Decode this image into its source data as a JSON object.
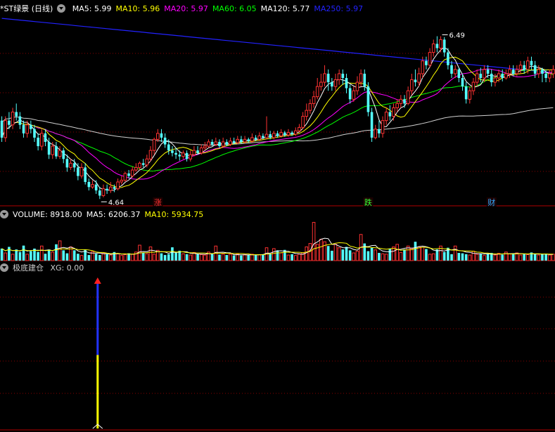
{
  "main_panel": {
    "title": "*ST绿景 (日线)",
    "ma_labels": [
      {
        "text": "MA5: 5.99",
        "color": "#ffffff"
      },
      {
        "text": "MA10: 5.96",
        "color": "#ffff00"
      },
      {
        "text": "MA20: 5.97",
        "color": "#ff00ff"
      },
      {
        "text": "MA60: 6.05",
        "color": "#00ff00"
      },
      {
        "text": "MA120: 5.77",
        "color": "#ffffff"
      },
      {
        "text": "MA250: 5.97",
        "color": "#2222ff"
      }
    ],
    "markers": [
      {
        "text": "涨",
        "color": "#ff3333",
        "index": 43
      },
      {
        "text": "跌",
        "color": "#33ff33",
        "index": 101
      },
      {
        "text": "财",
        "color": "#33aaff",
        "index": 135
      }
    ],
    "low_label": "4.64",
    "high_label": "6.49"
  },
  "volume_panel": {
    "labels": [
      {
        "text": "VOLUME: 8918.00",
        "color": "#ffffff"
      },
      {
        "text": "MA5: 6206.37",
        "color": "#ffffff"
      },
      {
        "text": "MA10: 5934.75",
        "color": "#ffff00"
      }
    ]
  },
  "indicator_panel": {
    "title": "极底建仓",
    "labels": [
      {
        "text": "XG: 0.00",
        "color": "#cccccc"
      }
    ]
  },
  "colors": {
    "up": "#ff3232",
    "down": "#54ffff",
    "grid": "#8a0000"
  },
  "chart_data": [
    {
      "type": "candlestick",
      "price_range": [
        4.5,
        6.75
      ],
      "candles": [
        [
          5.5,
          5.3,
          5.55,
          5.25
        ],
        [
          5.3,
          5.5,
          5.55,
          5.25
        ],
        [
          5.5,
          5.45,
          5.6,
          5.4
        ],
        [
          5.45,
          5.6,
          5.65,
          5.4
        ],
        [
          5.6,
          5.55,
          5.7,
          5.5
        ],
        [
          5.55,
          5.45,
          5.6,
          5.4
        ],
        [
          5.45,
          5.35,
          5.5,
          5.3
        ],
        [
          5.35,
          5.45,
          5.5,
          5.3
        ],
        [
          5.45,
          5.4,
          5.5,
          5.35
        ],
        [
          5.4,
          5.3,
          5.45,
          5.25
        ],
        [
          5.3,
          5.2,
          5.35,
          5.15
        ],
        [
          5.2,
          5.35,
          5.4,
          5.15
        ],
        [
          5.35,
          5.25,
          5.4,
          5.2
        ],
        [
          5.25,
          5.1,
          5.3,
          5.05
        ],
        [
          5.1,
          5.2,
          5.25,
          5.05
        ],
        [
          5.2,
          5.08,
          5.25,
          5.05
        ],
        [
          5.08,
          5.15,
          5.2,
          5.05
        ],
        [
          5.15,
          5.05,
          5.18,
          5.0
        ],
        [
          5.05,
          4.95,
          5.1,
          4.9
        ],
        [
          4.95,
          5.0,
          5.05,
          4.92
        ],
        [
          5.0,
          4.95,
          5.05,
          4.9
        ],
        [
          4.95,
          4.85,
          5.0,
          4.8
        ],
        [
          4.85,
          4.95,
          5.0,
          4.82
        ],
        [
          4.95,
          4.78,
          5.0,
          4.75
        ],
        [
          4.78,
          4.72,
          4.82,
          4.68
        ],
        [
          4.72,
          4.75,
          4.8,
          4.7
        ],
        [
          4.75,
          4.68,
          4.8,
          4.64
        ],
        [
          4.68,
          4.62,
          4.72,
          4.58
        ],
        [
          4.62,
          4.7,
          4.75,
          4.6
        ],
        [
          4.7,
          4.68,
          4.75,
          4.64
        ],
        [
          4.68,
          4.72,
          4.78,
          4.65
        ],
        [
          4.72,
          4.7,
          4.75,
          4.66
        ],
        [
          4.7,
          4.78,
          4.82,
          4.68
        ],
        [
          4.78,
          4.8,
          4.85,
          4.75
        ],
        [
          4.8,
          4.88,
          4.9,
          4.78
        ],
        [
          4.88,
          4.85,
          4.92,
          4.82
        ],
        [
          4.85,
          4.92,
          4.96,
          4.83
        ],
        [
          4.92,
          4.95,
          5.0,
          4.9
        ],
        [
          4.95,
          5.0,
          5.02,
          4.92
        ],
        [
          5.0,
          4.98,
          5.05,
          4.95
        ],
        [
          4.98,
          5.05,
          5.1,
          4.95
        ],
        [
          5.05,
          5.15,
          5.2,
          5.02
        ],
        [
          5.15,
          5.28,
          5.3,
          5.1
        ],
        [
          5.28,
          5.35,
          5.4,
          5.25
        ],
        [
          5.35,
          5.3,
          5.4,
          5.25
        ],
        [
          5.3,
          5.22,
          5.35,
          5.18
        ],
        [
          5.22,
          5.15,
          5.28,
          5.1
        ],
        [
          5.15,
          5.12,
          5.2,
          5.08
        ],
        [
          5.12,
          5.1,
          5.18,
          5.05
        ],
        [
          5.1,
          5.08,
          5.15,
          5.03
        ],
        [
          5.08,
          5.12,
          5.15,
          5.05
        ],
        [
          5.12,
          5.05,
          5.15,
          5.02
        ],
        [
          5.05,
          5.1,
          5.15,
          5.02
        ],
        [
          5.1,
          5.15,
          5.2,
          5.08
        ],
        [
          5.15,
          5.12,
          5.2,
          5.1
        ],
        [
          5.12,
          5.18,
          5.22,
          5.1
        ],
        [
          5.18,
          5.2,
          5.25,
          5.15
        ],
        [
          5.2,
          5.25,
          5.28,
          5.18
        ],
        [
          5.25,
          5.22,
          5.28,
          5.2
        ],
        [
          5.22,
          5.25,
          5.3,
          5.2
        ],
        [
          5.25,
          5.2,
          5.28,
          5.18
        ],
        [
          5.2,
          5.25,
          5.3,
          5.18
        ],
        [
          5.25,
          5.22,
          5.28,
          5.2
        ],
        [
          5.22,
          5.26,
          5.3,
          5.2
        ],
        [
          5.26,
          5.24,
          5.3,
          5.22
        ],
        [
          5.24,
          5.28,
          5.32,
          5.22
        ],
        [
          5.28,
          5.25,
          5.32,
          5.23
        ],
        [
          5.25,
          5.28,
          5.32,
          5.23
        ],
        [
          5.28,
          5.26,
          5.3,
          5.24
        ],
        [
          5.26,
          5.3,
          5.35,
          5.24
        ],
        [
          5.3,
          5.28,
          5.33,
          5.26
        ],
        [
          5.28,
          5.32,
          5.36,
          5.26
        ],
        [
          5.32,
          5.3,
          5.35,
          5.28
        ],
        [
          5.3,
          5.34,
          5.55,
          5.28
        ],
        [
          5.34,
          5.3,
          5.38,
          5.28
        ],
        [
          5.3,
          5.35,
          5.38,
          5.28
        ],
        [
          5.35,
          5.32,
          5.38,
          5.3
        ],
        [
          5.32,
          5.36,
          5.4,
          5.3
        ],
        [
          5.36,
          5.33,
          5.38,
          5.31
        ],
        [
          5.33,
          5.36,
          5.4,
          5.31
        ],
        [
          5.36,
          5.34,
          5.38,
          5.32
        ],
        [
          5.34,
          5.38,
          5.42,
          5.32
        ],
        [
          5.38,
          5.42,
          5.46,
          5.36
        ],
        [
          5.42,
          5.55,
          5.6,
          5.4
        ],
        [
          5.55,
          5.62,
          5.7,
          5.5
        ],
        [
          5.62,
          5.7,
          5.75,
          5.58
        ],
        [
          5.7,
          5.78,
          5.85,
          5.65
        ],
        [
          5.78,
          5.9,
          6.0,
          5.75
        ],
        [
          5.9,
          5.95,
          6.05,
          5.85
        ],
        [
          5.95,
          6.05,
          6.15,
          5.9
        ],
        [
          6.05,
          5.95,
          6.1,
          5.85
        ],
        [
          5.95,
          5.9,
          6.0,
          5.85
        ],
        [
          5.9,
          5.98,
          6.05,
          5.85
        ],
        [
          5.98,
          6.05,
          6.1,
          5.92
        ],
        [
          6.05,
          6.0,
          6.1,
          5.92
        ],
        [
          6.0,
          5.88,
          6.05,
          5.82
        ],
        [
          5.88,
          5.75,
          5.92,
          5.7
        ],
        [
          5.75,
          5.85,
          5.9,
          5.72
        ],
        [
          5.85,
          5.95,
          6.02,
          5.8
        ],
        [
          5.95,
          6.05,
          6.1,
          5.9
        ],
        [
          6.05,
          5.9,
          6.1,
          5.85
        ],
        [
          5.9,
          5.6,
          5.95,
          5.55
        ],
        [
          5.6,
          5.3,
          5.65,
          5.25
        ],
        [
          5.3,
          5.4,
          5.45,
          5.28
        ],
        [
          5.4,
          5.35,
          5.5,
          5.3
        ],
        [
          5.35,
          5.5,
          5.55,
          5.3
        ],
        [
          5.5,
          5.6,
          5.65,
          5.45
        ],
        [
          5.6,
          5.55,
          5.68,
          5.5
        ],
        [
          5.55,
          5.65,
          5.7,
          5.5
        ],
        [
          5.65,
          5.7,
          5.75,
          5.6
        ],
        [
          5.7,
          5.75,
          5.8,
          5.65
        ],
        [
          5.75,
          5.7,
          5.8,
          5.65
        ],
        [
          5.7,
          5.85,
          5.9,
          5.68
        ],
        [
          5.85,
          5.98,
          6.05,
          5.8
        ],
        [
          5.98,
          5.95,
          6.1,
          5.9
        ],
        [
          5.95,
          6.05,
          6.12,
          5.9
        ],
        [
          6.05,
          6.2,
          6.25,
          6.0
        ],
        [
          6.2,
          6.15,
          6.25,
          6.1
        ],
        [
          6.15,
          6.3,
          6.35,
          6.12
        ],
        [
          6.3,
          6.4,
          6.45,
          6.25
        ],
        [
          6.4,
          6.35,
          6.49,
          6.3
        ],
        [
          6.35,
          6.45,
          6.49,
          6.3
        ],
        [
          6.45,
          6.3,
          6.48,
          6.25
        ],
        [
          6.3,
          6.15,
          6.35,
          6.1
        ],
        [
          6.15,
          6.05,
          6.2,
          6.0
        ],
        [
          6.05,
          6.1,
          6.15,
          6.0
        ],
        [
          6.1,
          6.0,
          6.12,
          5.95
        ],
        [
          6.0,
          5.9,
          6.05,
          5.85
        ],
        [
          5.9,
          5.75,
          5.95,
          5.7
        ],
        [
          5.75,
          5.85,
          5.9,
          5.7
        ],
        [
          5.85,
          5.95,
          6.0,
          5.8
        ],
        [
          5.95,
          6.05,
          6.1,
          5.9
        ],
        [
          6.05,
          6.0,
          6.12,
          5.95
        ],
        [
          6.0,
          6.1,
          6.15,
          5.95
        ],
        [
          6.1,
          6.05,
          6.15,
          6.0
        ],
        [
          6.05,
          5.95,
          6.1,
          5.9
        ],
        [
          5.95,
          6.0,
          6.05,
          5.9
        ],
        [
          6.0,
          6.05,
          6.1,
          5.95
        ],
        [
          6.05,
          6.0,
          6.1,
          5.96
        ],
        [
          6.0,
          6.05,
          6.1,
          5.98
        ],
        [
          6.05,
          6.1,
          6.15,
          6.0
        ],
        [
          6.1,
          6.05,
          6.15,
          6.02
        ],
        [
          6.05,
          6.1,
          6.15,
          6.02
        ],
        [
          6.1,
          6.15,
          6.2,
          6.05
        ],
        [
          6.15,
          6.1,
          6.2,
          6.05
        ],
        [
          6.1,
          6.2,
          6.25,
          6.05
        ],
        [
          6.2,
          6.15,
          6.25,
          6.1
        ],
        [
          6.15,
          6.05,
          6.2,
          6.0
        ],
        [
          6.05,
          6.1,
          6.15,
          6.0
        ],
        [
          6.1,
          6.05,
          6.12,
          5.95
        ],
        [
          6.05,
          6.0,
          6.1,
          5.95
        ],
        [
          6.0,
          6.05,
          6.1,
          5.95
        ],
        [
          6.05,
          6.1,
          6.15,
          6.0
        ]
      ],
      "low_label_index": 27,
      "high_label_index": 121
    },
    {
      "type": "bar",
      "ylim": [
        0,
        9500
      ],
      "values": [
        2800,
        1800,
        3200,
        1500,
        2600,
        2000,
        3500,
        1500,
        2200,
        2800,
        2000,
        3400,
        1600,
        2600,
        2000,
        3800,
        4600,
        2400,
        1700,
        3200,
        2400,
        1600,
        1200,
        2600,
        1300,
        2100,
        1600,
        1300,
        1700,
        1500,
        1300,
        2000,
        1600,
        1200,
        1400,
        1700,
        1500,
        2000,
        3600,
        1800,
        1600,
        3200,
        1500,
        2400,
        1700,
        1300,
        1500,
        3100,
        1800,
        2300,
        1600,
        1500,
        1300,
        1900,
        1500,
        1400,
        1300,
        2000,
        1500,
        3400,
        1400,
        1500,
        1300,
        1500,
        1200,
        1500,
        1200,
        1400,
        1300,
        1500,
        1300,
        1400,
        1500,
        3000,
        1500,
        2800,
        2400,
        1800,
        2500,
        1300,
        1500,
        1200,
        1500,
        1800,
        3200,
        4000,
        8918,
        3800,
        5000,
        4400,
        3400,
        2300,
        3800,
        3000,
        2600,
        3200,
        2400,
        1800,
        2200,
        6100,
        4000,
        2200,
        3000,
        2500,
        1800,
        1600,
        1500,
        2800,
        3200,
        3800,
        1900,
        2600,
        3400,
        2800,
        4400,
        3200,
        3100,
        2700,
        1500,
        1600,
        2600,
        3400,
        2000,
        3000,
        1500,
        3400,
        1800,
        1700,
        1500,
        1300,
        2200,
        1500,
        1600,
        1200,
        1500,
        1800,
        1300,
        1700,
        1400,
        2000,
        1600,
        1500,
        1800,
        1300,
        1600,
        1400,
        1900,
        1500,
        1300,
        1500,
        1600,
        1300,
        1500
      ]
    }
  ]
}
